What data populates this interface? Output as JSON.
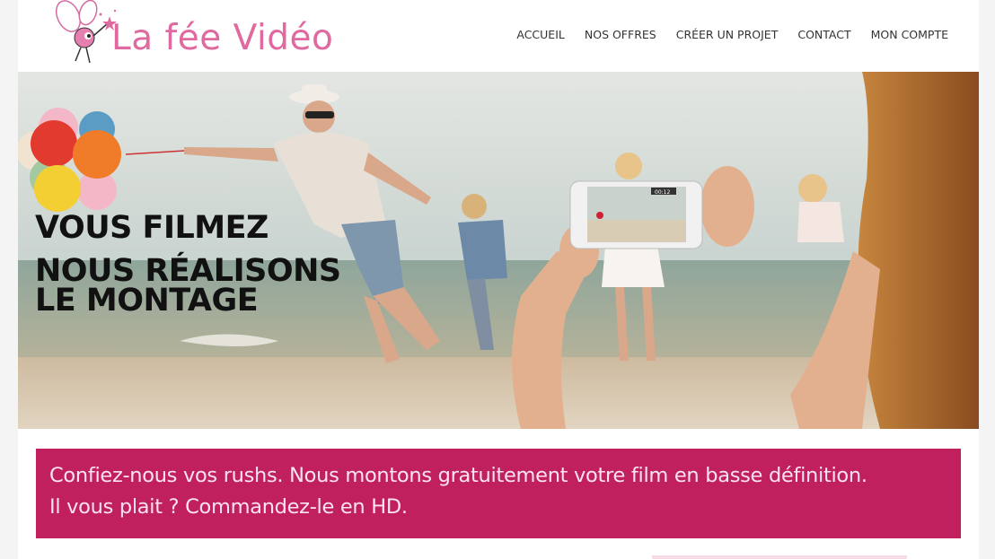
{
  "header": {
    "logo_text": "La fée Vidéo",
    "nav": [
      "ACCUEIL",
      "NOS OFFRES",
      "CRÉER UN PROJET",
      "CONTACT",
      "MON COMPTE"
    ]
  },
  "hero": {
    "line1": "VOUS FILMEZ",
    "line2": "NOUS RÉALISONS",
    "line3": "LE MONTAGE",
    "phone_timer": "00:12"
  },
  "banner": {
    "line1": "Confiez-nous vos rushs. Nous montons gratuitement votre film en basse définition.",
    "line2": "Il vous plait ? Commandez-le en HD."
  },
  "colors": {
    "brand_pink": "#e06aa0",
    "banner_bg": "#c0205e",
    "banner_text": "#fbe3ef"
  }
}
